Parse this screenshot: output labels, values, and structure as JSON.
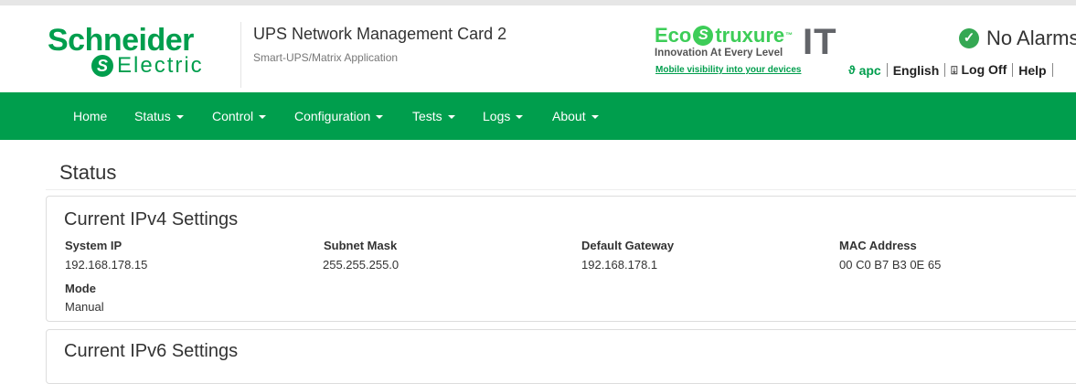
{
  "header": {
    "logo_line1": "Schneider",
    "logo_mark": "S",
    "logo_line2": "Electric",
    "app_title": "UPS Network Management Card 2",
    "app_subtitle": "Smart-UPS/Matrix Application",
    "eco_brand_a": "Eco",
    "eco_mark": "S",
    "eco_brand_b": "truxure",
    "eco_tm": "™",
    "eco_tagline": "Innovation At Every Level",
    "eco_link": "Mobile visibility into your devices",
    "it_label": "IT",
    "alarm_status": "No Alarms",
    "links": {
      "apc": "apc",
      "language": "English",
      "logoff": "Log Off",
      "help": "Help"
    }
  },
  "nav": {
    "items": [
      {
        "label": "Home"
      },
      {
        "label": "Status"
      },
      {
        "label": "Control"
      },
      {
        "label": "Configuration"
      },
      {
        "label": "Tests"
      },
      {
        "label": "Logs"
      },
      {
        "label": "About"
      }
    ]
  },
  "main": {
    "page_title": "Status",
    "ipv4": {
      "title": "Current IPv4 Settings",
      "system_ip_label": "System IP",
      "system_ip": "192.168.178.15",
      "subnet_label": "Subnet Mask",
      "subnet": "255.255.255.0",
      "gateway_label": "Default Gateway",
      "gateway": "192.168.178.1",
      "mac_label": "MAC Address",
      "mac": "00 C0 B7 B3 0E 65",
      "mode_label": "Mode",
      "mode": "Manual"
    },
    "ipv6": {
      "title": "Current IPv6 Settings"
    }
  },
  "colors": {
    "brand_green": "#009e4d",
    "eco_green": "#3dcd58"
  }
}
